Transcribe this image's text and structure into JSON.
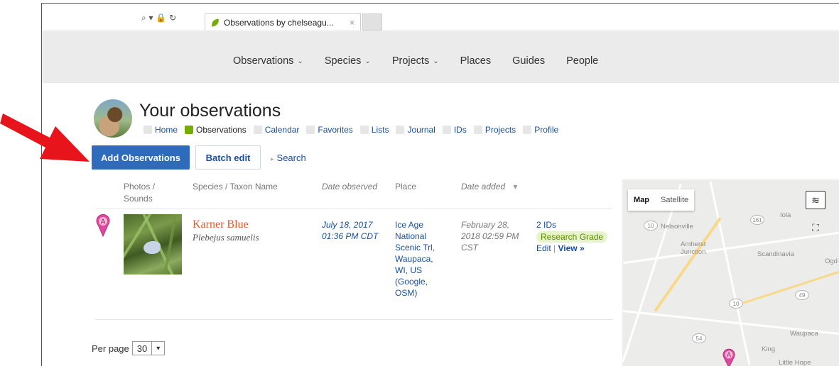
{
  "browser": {
    "tab_title": "Observations by chelseagu...",
    "tab_close": "×",
    "address_icons": "⌕ ▾ 🔒 ↻"
  },
  "nav": {
    "items": [
      {
        "label": "Observations",
        "chevron": "⌄"
      },
      {
        "label": "Species",
        "chevron": "⌄"
      },
      {
        "label": "Projects",
        "chevron": "⌄"
      },
      {
        "label": "Places",
        "chevron": ""
      },
      {
        "label": "Guides",
        "chevron": ""
      },
      {
        "label": "People",
        "chevron": ""
      }
    ]
  },
  "header": {
    "title": "Your observations",
    "subnav": [
      "Home",
      "Observations",
      "Calendar",
      "Favorites",
      "Lists",
      "Journal",
      "IDs",
      "Projects",
      "Profile"
    ]
  },
  "actions": {
    "add_label": "Add Observations",
    "batch_label": "Batch edit",
    "search_label": "Search",
    "search_prefix": "▸"
  },
  "table": {
    "columns": {
      "photos_line1": "Photos /",
      "photos_line2": "Sounds",
      "species": "Species / Taxon Name",
      "date_observed": "Date observed",
      "place": "Place",
      "date_added": "Date added",
      "sort_caret": "▾"
    },
    "rows": [
      {
        "marker": "A",
        "common_name": "Karner Blue",
        "scientific_name": "Plebejus samuelis",
        "date_observed_1": "July 18, 2017",
        "date_observed_2": "01:36 PM CDT",
        "place_lines": [
          "Ice Age",
          "National",
          "Scenic Trl,",
          "Waupaca,",
          "WI, US",
          "(Google,",
          "OSM)"
        ],
        "date_added_1": "February 28,",
        "date_added_2": "2018 02:59 PM",
        "date_added_3": "CST",
        "ids_count": "2 IDs",
        "quality": "Research Grade",
        "edit": "Edit",
        "sep": "|",
        "view": "View »"
      }
    ]
  },
  "pagination": {
    "label": "Per page",
    "value": "30",
    "caret": "▾"
  },
  "map": {
    "type_map": "Map",
    "type_satellite": "Satellite",
    "layers_glyph": "≋",
    "fullscreen_glyph": "⛶",
    "marker": "A",
    "towns": {
      "nelsonville": "Nelsonville",
      "amherst": "Amherst",
      "junction": "Junction",
      "iola": "Iola",
      "scandinavia": "Scandinavia",
      "ogd": "Ogd",
      "waupaca": "Waupaca",
      "king": "King",
      "little_hope": "Little Hope"
    },
    "shields": {
      "s10": "10",
      "s161": "161",
      "s49": "49",
      "s10b": "10",
      "s54": "54"
    }
  },
  "colors": {
    "accent_blue": "#2e6bbd",
    "link_blue": "#1a4f9c",
    "taxon_orange": "#e05a2b",
    "inat_green": "#74ac00",
    "marker_pink": "#e0479e",
    "arrow_red": "#e8141b"
  }
}
